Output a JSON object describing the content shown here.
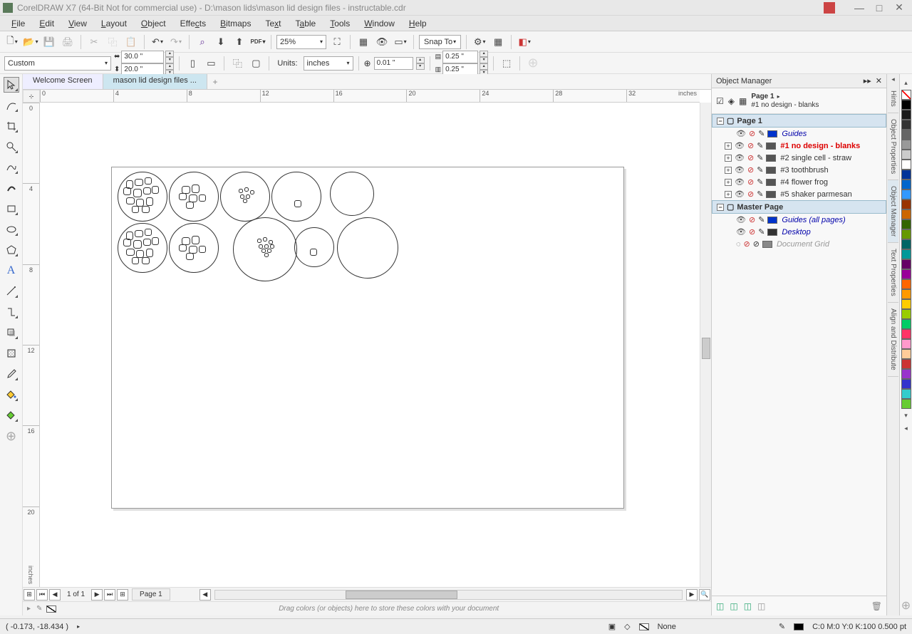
{
  "title": "CorelDRAW X7 (64-Bit Not for commercial use) - D:\\mason lids\\mason lid design files - instructable.cdr",
  "menus": [
    "File",
    "Edit",
    "View",
    "Layout",
    "Object",
    "Effects",
    "Bitmaps",
    "Text",
    "Table",
    "Tools",
    "Window",
    "Help"
  ],
  "toolbar": {
    "zoom": "25%",
    "snap_to": "Snap To"
  },
  "propbar": {
    "page_size": "Custom",
    "width": "30.0 \"",
    "height": "20.0 \"",
    "units_label": "Units:",
    "units": "inches",
    "nudge": "0.01 \"",
    "dup_x": "0.25 \"",
    "dup_y": "0.25 \""
  },
  "tabs": {
    "welcome": "Welcome Screen",
    "doc": "mason lid design files ..."
  },
  "ruler": {
    "h_ticks": [
      "0",
      "4",
      "8",
      "12",
      "16",
      "20",
      "24",
      "28",
      "32"
    ],
    "h_unit": "inches",
    "v_ticks": [
      "0",
      "4",
      "8",
      "12",
      "16",
      "20"
    ],
    "v_unit": "inches"
  },
  "pagenav": {
    "count": "1 of 1",
    "page_tab": "Page 1"
  },
  "color_drop_hint": "Drag colors (or objects) here to store these colors with your document",
  "docker": {
    "title": "Object Manager",
    "current_page": "Page 1",
    "current_layer": "#1 no design - blanks",
    "page1": "Page 1",
    "layers": [
      {
        "name": "Guides",
        "color": "#0033cc",
        "style": "blue"
      },
      {
        "name": "#1 no design - blanks",
        "color": "#555555",
        "style": "red"
      },
      {
        "name": "#2 single cell - straw",
        "color": "#555555",
        "style": ""
      },
      {
        "name": "#3 toothbrush",
        "color": "#555555",
        "style": ""
      },
      {
        "name": "#4 flower frog",
        "color": "#555555",
        "style": ""
      },
      {
        "name": "#5 shaker parmesan",
        "color": "#555555",
        "style": ""
      }
    ],
    "master_page": "Master Page",
    "master_layers": [
      {
        "name": "Guides (all pages)",
        "color": "#0033cc",
        "style": "blue"
      },
      {
        "name": "Desktop",
        "color": "#333333",
        "style": "blue"
      },
      {
        "name": "Document Grid",
        "color": "#888888",
        "style": "gray"
      }
    ]
  },
  "right_tabs": [
    "Hints",
    "Object Properties",
    "Object Manager",
    "Text Properties",
    "Align and Distribute"
  ],
  "palette_colors": [
    "none",
    "#000000",
    "#1a1a1a",
    "#333333",
    "#666666",
    "#999999",
    "#cccccc",
    "#ffffff",
    "#003399",
    "#0066cc",
    "#3399ff",
    "#993300",
    "#cc6600",
    "#336600",
    "#669900",
    "#006666",
    "#009999",
    "#660066",
    "#990099",
    "#ff6600",
    "#ff9900",
    "#ffcc00",
    "#99cc00",
    "#00cc66",
    "#ff3366",
    "#ff99cc",
    "#ffcc99",
    "#cc3333",
    "#9933cc",
    "#3333cc",
    "#33cccc",
    "#66cc33"
  ],
  "status": {
    "coords": "( -0.173, -18.434 )",
    "fill_label": "None",
    "outline": "C:0 M:0 Y:0 K:100 0.500 pt"
  }
}
